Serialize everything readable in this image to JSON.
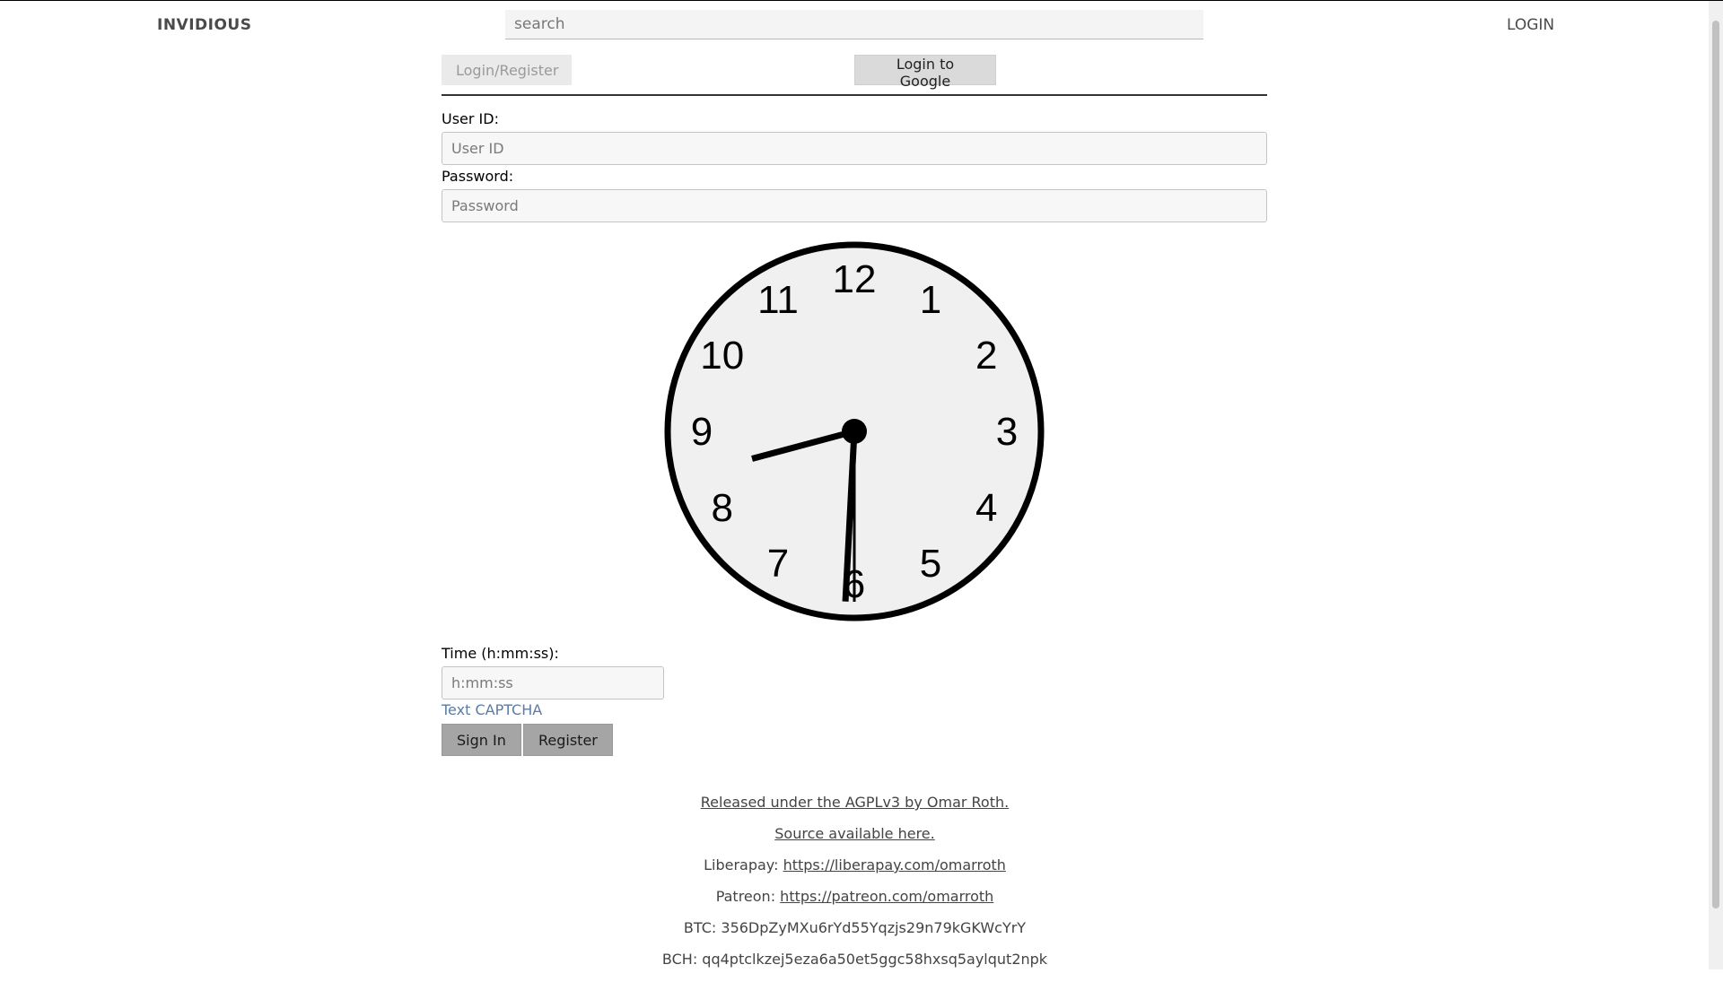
{
  "header": {
    "brand": "INVIDIOUS",
    "search_placeholder": "search",
    "login_label": "LOGIN"
  },
  "tabs": {
    "login_register": "Login/Register",
    "login_google": "Login to Google"
  },
  "form": {
    "user_id_label": "User ID:",
    "user_id_placeholder": "User ID",
    "password_label": "Password:",
    "password_placeholder": "Password",
    "clock": {
      "numerals": [
        "12",
        "1",
        "2",
        "3",
        "4",
        "5",
        "6",
        "7",
        "8",
        "9",
        "10",
        "11"
      ],
      "hour": 8,
      "minute": 30,
      "second": 30
    },
    "time_label": "Time (h:mm:ss):",
    "time_placeholder": "h:mm:ss",
    "captcha_link": "Text CAPTCHA",
    "sign_in_label": "Sign In",
    "register_label": "Register"
  },
  "footer": {
    "license_text": "Released under the AGPLv3 by Omar Roth.",
    "source_text": "Source available here.",
    "liberapay_label": "Liberapay: ",
    "liberapay_url": "https://liberapay.com/omarroth",
    "patreon_label": "Patreon: ",
    "patreon_url": "https://patreon.com/omarroth",
    "btc_text": "BTC: 356DpZyMXu6rYd55Yqzjs29n79kGKWcYrY",
    "bch_text": "BCH: qq4ptclkzej5eza6a50et5ggc58hxsq5aylqut2npk"
  }
}
